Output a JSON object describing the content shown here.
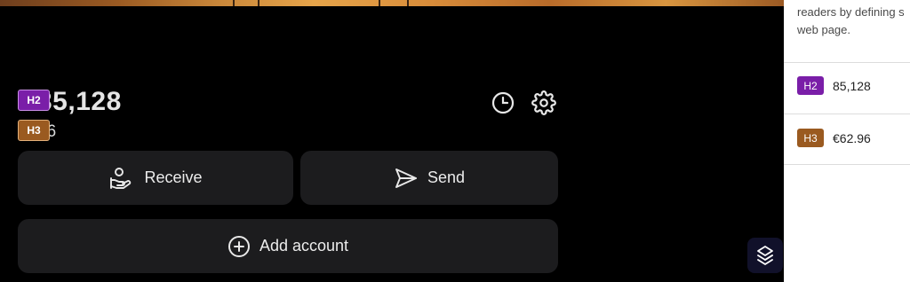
{
  "wallet": {
    "balance": "85,128",
    "balance_visible": "35,128",
    "sub_balance": "€62.96",
    "sub_balance_visible": "96"
  },
  "tags": {
    "h2": "H2",
    "h3": "H3"
  },
  "actions": {
    "receive_label": "Receive",
    "send_label": "Send",
    "add_account_label": "Add account"
  },
  "side_panel": {
    "intro_line1": "readers by defining s",
    "intro_line2": "web page.",
    "items": [
      {
        "tag": "H2",
        "value": "85,128",
        "color": "#7a1ea8"
      },
      {
        "tag": "H3",
        "value": "€62.96",
        "color": "#9a5a20"
      }
    ]
  },
  "icons": {
    "history": "clock-icon",
    "settings": "gear-icon",
    "receive": "hand-coin-icon",
    "send": "paper-plane-icon",
    "add": "plus-circle-icon",
    "brand": "brand-logo-icon"
  }
}
